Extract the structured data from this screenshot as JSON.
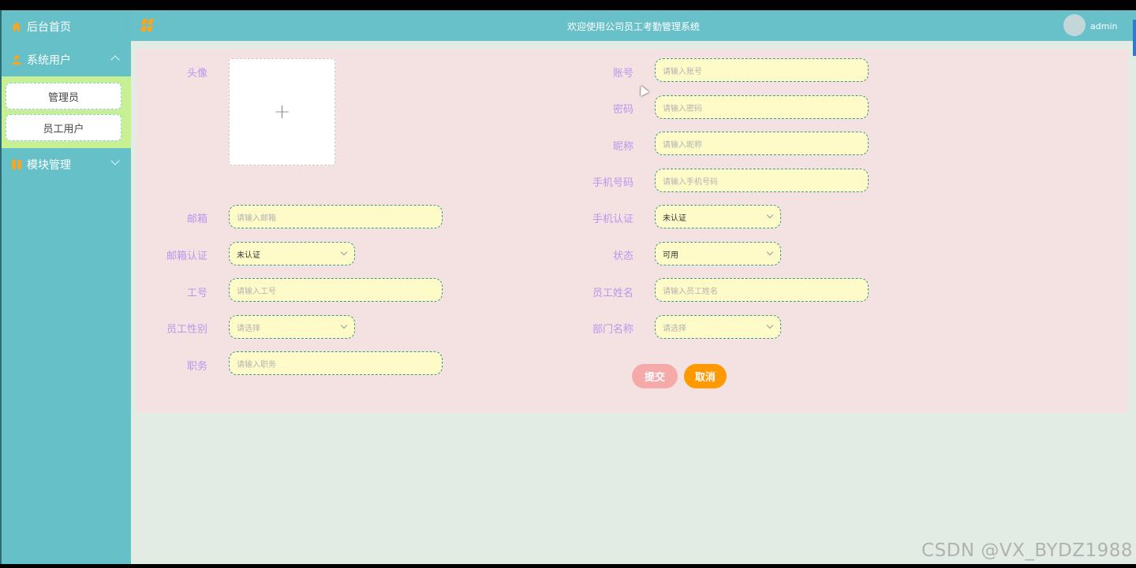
{
  "sidebar": {
    "items": [
      {
        "label": "后台首页",
        "icon": "home-icon"
      },
      {
        "label": "系统用户",
        "icon": "user-icon",
        "expanded": true,
        "children": [
          {
            "label": "管理员"
          },
          {
            "label": "员工用户"
          }
        ]
      },
      {
        "label": "模块管理",
        "icon": "grid-icon",
        "expanded": false
      }
    ]
  },
  "header": {
    "title": "欢迎使用公司员工考勤管理系统",
    "username": "admin"
  },
  "form": {
    "avatar_label": "头像",
    "avatar_upload_symbol": "+",
    "account": {
      "label": "账号",
      "placeholder": "请输入账号"
    },
    "password": {
      "label": "密码",
      "placeholder": "请输入密码"
    },
    "nickname": {
      "label": "昵称",
      "placeholder": "请输入昵称"
    },
    "phone": {
      "label": "手机号码",
      "placeholder": "请输入手机号码"
    },
    "email": {
      "label": "邮箱",
      "placeholder": "请输入邮箱"
    },
    "phone_verify": {
      "label": "手机认证",
      "value": "未认证"
    },
    "email_verify": {
      "label": "邮箱认证",
      "value": "未认证"
    },
    "status": {
      "label": "状态",
      "value": "可用"
    },
    "employee_no": {
      "label": "工号",
      "placeholder": "请输入工号"
    },
    "employee_name": {
      "label": "员工姓名",
      "placeholder": "请输入员工姓名"
    },
    "gender": {
      "label": "员工性别",
      "placeholder": "请选择"
    },
    "department": {
      "label": "部门名称",
      "placeholder": "请选择"
    },
    "position": {
      "label": "职务",
      "placeholder": "请输入职务"
    },
    "submit_label": "提交",
    "cancel_label": "取消"
  },
  "watermark": "CSDN @VX_BYDZ1988",
  "colors": {
    "sidebar": "#66c0c8",
    "header": "#68c0c8",
    "panel": "#f4e1e1",
    "label": "#bb96ee",
    "field_bg": "#fffbc8",
    "submit": "#f6a9a9",
    "cancel": "#ff9900",
    "submenu": "#c6f092"
  }
}
